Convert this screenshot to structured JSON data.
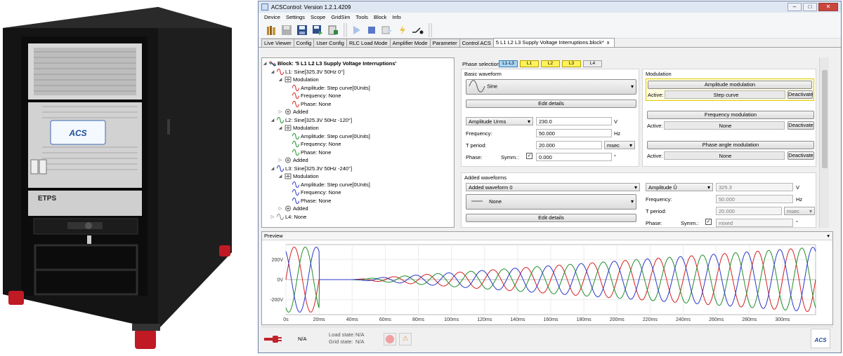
{
  "photo": {
    "brand_top": "ETPS",
    "brand_mid": "ETPS",
    "logo": "ACS"
  },
  "window": {
    "title": "ACSControl: Version 1.2.1.4209",
    "min": "–",
    "max": "□",
    "close": "✕"
  },
  "menu": [
    "Device",
    "Settings",
    "Scope",
    "GridSim",
    "Tools",
    "Block",
    "Info"
  ],
  "tabs": [
    "Live Viewer",
    "Config",
    "User Config",
    "RLC Load Mode",
    "Amplifier Mode",
    "Parameter",
    "Control ACS"
  ],
  "active_tab": {
    "label": "5 L1 L2 L3 Supply Voltage Interruptions.block*",
    "close": "x"
  },
  "tree": {
    "root": "Block: '5 L1 L2 L3 Supply Voltage Interruptions'",
    "rows": [
      {
        "indent": 1,
        "exp": "◢",
        "icon": "sine-red",
        "text": "L1: Sine[325.3V 50Hz 0°]"
      },
      {
        "indent": 2,
        "exp": "◢",
        "icon": "mod",
        "text": "Modulation"
      },
      {
        "indent": 3,
        "exp": "",
        "icon": "sine-red",
        "text": "Amplitude: Step curve[0Units]"
      },
      {
        "indent": 3,
        "exp": "",
        "icon": "sine-red",
        "text": "Frequency: None"
      },
      {
        "indent": 3,
        "exp": "",
        "icon": "sine-red",
        "text": "Phase: None"
      },
      {
        "indent": 2,
        "exp": "▷",
        "icon": "add",
        "text": "Added"
      },
      {
        "indent": 1,
        "exp": "◢",
        "icon": "sine-green",
        "text": "L2: Sine[325.3V 50Hz -120°]"
      },
      {
        "indent": 2,
        "exp": "◢",
        "icon": "mod",
        "text": "Modulation"
      },
      {
        "indent": 3,
        "exp": "",
        "icon": "sine-green",
        "text": "Amplitude: Step curve[0Units]"
      },
      {
        "indent": 3,
        "exp": "",
        "icon": "sine-green",
        "text": "Frequency: None"
      },
      {
        "indent": 3,
        "exp": "",
        "icon": "sine-green",
        "text": "Phase: None"
      },
      {
        "indent": 2,
        "exp": "▷",
        "icon": "add",
        "text": "Added"
      },
      {
        "indent": 1,
        "exp": "◢",
        "icon": "sine-blue",
        "text": "L3: Sine[325.3V 50Hz -240°]"
      },
      {
        "indent": 2,
        "exp": "◢",
        "icon": "mod",
        "text": "Modulation"
      },
      {
        "indent": 3,
        "exp": "",
        "icon": "sine-blue",
        "text": "Amplitude: Step curve[0Units]"
      },
      {
        "indent": 3,
        "exp": "",
        "icon": "sine-blue",
        "text": "Frequency: None"
      },
      {
        "indent": 3,
        "exp": "",
        "icon": "sine-blue",
        "text": "Phase: None"
      },
      {
        "indent": 2,
        "exp": "▷",
        "icon": "add",
        "text": "Added"
      },
      {
        "indent": 1,
        "exp": "▷",
        "icon": "sine-grey",
        "text": "L4: None"
      }
    ]
  },
  "phase_selection": {
    "label": "Phase selection:",
    "buttons": [
      "L1-L3",
      "L1",
      "L2",
      "L3",
      "L4"
    ]
  },
  "basic": {
    "title": "Basic waveform",
    "waveform": "Sine",
    "edit": "Edit details",
    "amp_mode": "Amplitude Urms",
    "amp_value": "230.0",
    "amp_unit": "V",
    "freq_label": "Frequency:",
    "freq_value": "50.000",
    "freq_unit": "Hz",
    "tperiod_label": "T period:",
    "tperiod_value": "20.000",
    "tperiod_unit": "msec",
    "phase_label": "Phase:",
    "symm_label": "Symm.:",
    "phase_value": "0.000",
    "phase_unit": "°"
  },
  "modulation": {
    "title": "Modulation",
    "amp": {
      "btn": "Amplitude modulation",
      "active_label": "Active:",
      "value": "Step curve",
      "deact": "Deactivate"
    },
    "freq": {
      "btn": "Frequency modulation",
      "active_label": "Active:",
      "value": "None",
      "deact": "Deactivate"
    },
    "phase": {
      "btn": "Phase angle modulation",
      "active_label": "Active:",
      "value": "None",
      "deact": "Deactivate"
    }
  },
  "added": {
    "title": "Added waveforms",
    "select": "Added waveform 0",
    "waveform": "None",
    "edit": "Edit details",
    "amp_mode": "Amplitude Û",
    "amp_value": "325.3",
    "amp_unit": "V",
    "freq_label": "Frequency:",
    "freq_value": "50.000",
    "freq_unit": "Hz",
    "tperiod_label": "T period:",
    "tperiod_value": "20.000",
    "tperiod_unit": "msec",
    "phase_label": "Phase:",
    "symm_label": "Symm.:",
    "phase_value": "mixed",
    "phase_unit": "°"
  },
  "preview": {
    "label": "Preview"
  },
  "status": {
    "conn": "N/A",
    "load_label": "Load state:",
    "load_value": "N/A",
    "grid_label": "Grid state:",
    "grid_value": "N/A",
    "logo": "ACS"
  },
  "colors": {
    "l1": "#d42020",
    "l2": "#1f8f2a",
    "l3": "#2a36c8",
    "grey": "#8a8a8a"
  },
  "chart_data": {
    "type": "line",
    "xlabel": "",
    "ylabel": "",
    "x_ticks": [
      "0s",
      "20ms",
      "40ms",
      "60ms",
      "80ms",
      "100ms",
      "120ms",
      "140ms",
      "160ms",
      "180ms",
      "200ms",
      "220ms",
      "240ms",
      "260ms",
      "280ms",
      "300ms"
    ],
    "y_ticks": [
      "200V",
      "0V",
      "-200V"
    ],
    "xlim": [
      0,
      320
    ],
    "ylim": [
      -350,
      350
    ],
    "frequency_hz": 50,
    "peak_v": 325.3,
    "envelope": {
      "full_until_ms": 20,
      "zero_until_ms": 40,
      "ramp_end_ms": 320
    },
    "series": [
      {
        "name": "L1",
        "phase_deg": 0
      },
      {
        "name": "L2",
        "phase_deg": -120
      },
      {
        "name": "L3",
        "phase_deg": -240
      }
    ]
  }
}
